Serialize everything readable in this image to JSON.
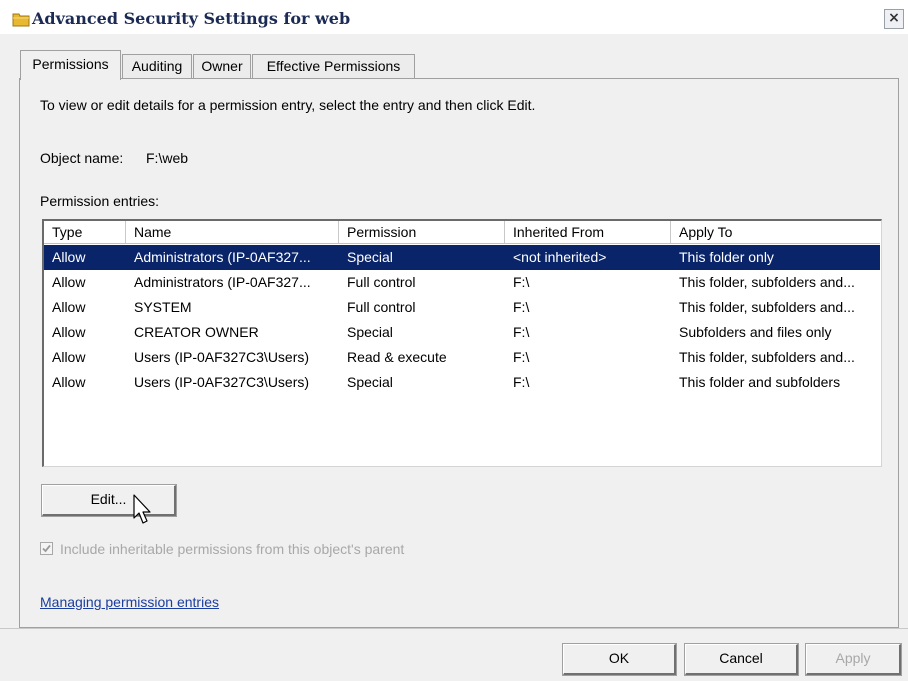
{
  "window": {
    "title": "Advanced Security Settings for web",
    "close_label": "×"
  },
  "tabs": [
    {
      "label": "Permissions",
      "active": true
    },
    {
      "label": "Auditing",
      "active": false
    },
    {
      "label": "Owner",
      "active": false
    },
    {
      "label": "Effective Permissions",
      "active": false
    }
  ],
  "instructions": "To view or edit details for a permission entry, select the entry and then click Edit.",
  "object": {
    "label": "Object name:",
    "value": "F:\\web"
  },
  "entries_label": "Permission entries:",
  "table": {
    "columns": [
      "Type",
      "Name",
      "Permission",
      "Inherited From",
      "Apply To"
    ],
    "rows": [
      [
        "Allow",
        "Administrators (IP-0AF327...",
        "Special",
        "<not inherited>",
        "This folder only"
      ],
      [
        "Allow",
        "Administrators (IP-0AF327...",
        "Full control",
        "F:\\",
        "This folder, subfolders and..."
      ],
      [
        "Allow",
        "SYSTEM",
        "Full control",
        "F:\\",
        "This folder, subfolders and..."
      ],
      [
        "Allow",
        "CREATOR OWNER",
        "Special",
        "F:\\",
        "Subfolders and files only"
      ],
      [
        "Allow",
        "Users (IP-0AF327C3\\Users)",
        "Read & execute",
        "F:\\",
        "This folder, subfolders and..."
      ],
      [
        "Allow",
        "Users (IP-0AF327C3\\Users)",
        "Special",
        "F:\\",
        "This folder and subfolders"
      ]
    ],
    "selected_row": 0
  },
  "edit_button": "Edit...",
  "inherit_checkbox": {
    "label": "Include inheritable permissions from this object's parent",
    "checked": true,
    "enabled": false
  },
  "help_link": "Managing permission entries",
  "footer": {
    "ok": "OK",
    "cancel": "Cancel",
    "apply": "Apply"
  },
  "colors": {
    "selection": "#0a246a",
    "link": "#1a3d9e",
    "folder_icon": "#e8b830"
  }
}
